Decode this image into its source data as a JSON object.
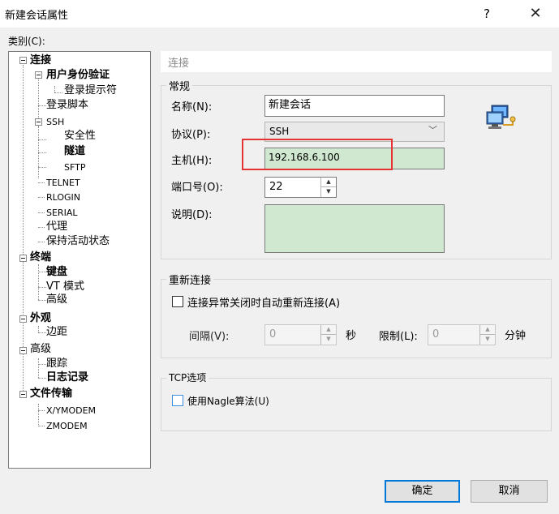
{
  "window": {
    "title": "新建会话属性",
    "help": "?",
    "close": "✕"
  },
  "category_label": "类别(C):",
  "tree": {
    "items": [
      "连接",
      "用户身份验证",
      "登录提示符",
      "登录脚本",
      "SSH",
      "安全性",
      "隧道",
      "SFTP",
      "TELNET",
      "RLOGIN",
      "SERIAL",
      "代理",
      "保持活动状态",
      "终端",
      "键盘",
      "VT 模式",
      "高级",
      "外观",
      "边距",
      "高级",
      "跟踪",
      "日志记录",
      "文件传输",
      "X/YMODEM",
      "ZMODEM"
    ]
  },
  "section_header": "连接",
  "general": {
    "title": "常规",
    "name_label": "名称(N):",
    "name_value": "新建会话",
    "protocol_label": "协议(P):",
    "protocol_value": "SSH",
    "host_label": "主机(H):",
    "host_value": "192.168.6.100",
    "port_label": "端口号(O):",
    "port_value": "22",
    "desc_label": "说明(D):"
  },
  "reconnect": {
    "title": "重新连接",
    "auto_label": "连接异常关闭时自动重新连接(A)",
    "interval_label": "间隔(V):",
    "interval_value": "0",
    "seconds": "秒",
    "limit_label": "限制(L):",
    "limit_value": "0",
    "minutes": "分钟"
  },
  "tcp": {
    "title": "TCP选项",
    "nagle_label": "使用Nagle算法(U)"
  },
  "buttons": {
    "ok": "确定",
    "cancel": "取消"
  },
  "icons": {
    "session": "computer-network-icon"
  },
  "colors": {
    "field_highlight": "#cfe8cf",
    "annotation": "#e53333",
    "default_button": "#0078d7"
  }
}
